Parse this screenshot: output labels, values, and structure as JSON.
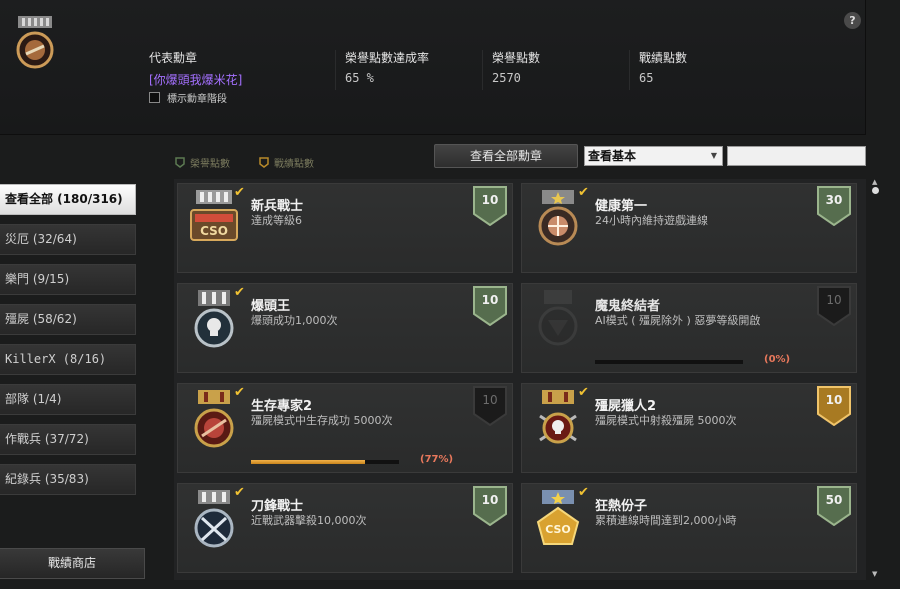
{
  "header": {
    "help_label": "?",
    "representative_medal_label": "代表勳章",
    "representative_medal_value": "[你爆頭我爆米花]",
    "completion_label": "榮譽點數達成率",
    "completion_value": "65 %",
    "honor_points_label": "榮譽點數",
    "honor_points_value": "2570",
    "record_points_label": "戰績點數",
    "record_points_value": "65",
    "show_step_label": "標示勳章階段"
  },
  "toolbar": {
    "legend_honor": "榮譽點數",
    "legend_record": "戰績點數",
    "view_all_button": "查看全部勳章",
    "filter_select": "查看基本",
    "search_value": ""
  },
  "sidebar": {
    "items": [
      {
        "label": "查看全部 (180/316)",
        "active": true
      },
      {
        "label": "災厄 (32/64)",
        "active": false
      },
      {
        "label": "樂門 (9/15)",
        "active": false
      },
      {
        "label": "殭屍 (58/62)",
        "active": false
      },
      {
        "label": "KillerX (8/16)",
        "active": false
      },
      {
        "label": "部隊 (1/4)",
        "active": false
      },
      {
        "label": "作戰兵 (37/72)",
        "active": false
      },
      {
        "label": "紀錄兵 (35/83)",
        "active": false
      }
    ],
    "shop_button": "戰績商店"
  },
  "medals": [
    {
      "title": "新兵戰士",
      "desc": "達成等級6",
      "points": "10",
      "badge": "green",
      "done": true,
      "progress": null,
      "progress_label": ""
    },
    {
      "title": "健康第一",
      "desc": "24小時內維持遊戲連線",
      "points": "30",
      "badge": "green",
      "done": true,
      "progress": null,
      "progress_label": ""
    },
    {
      "title": "爆頭王",
      "desc": "爆頭成功1,000次",
      "points": "10",
      "badge": "green",
      "done": true,
      "progress": null,
      "progress_label": ""
    },
    {
      "title": "魔鬼終結者",
      "desc": "AI模式 ( 殭屍除外 ) 惡夢等級開啟",
      "points": "10",
      "badge": "dark",
      "done": false,
      "progress": 0,
      "progress_label": "(0%)"
    },
    {
      "title": "生存專家2",
      "desc": "殭屍模式中生存成功 5000次",
      "points": "10",
      "badge": "dark",
      "done": true,
      "progress": 0.77,
      "progress_label": "(77%)"
    },
    {
      "title": "殭屍獵人2",
      "desc": "殭屍模式中射殺殭屍 5000次",
      "points": "10",
      "badge": "gold",
      "done": true,
      "progress": null,
      "progress_label": ""
    },
    {
      "title": "刀鋒戰士",
      "desc": "近戰武器擊殺10,000次",
      "points": "10",
      "badge": "green",
      "done": true,
      "progress": null,
      "progress_label": ""
    },
    {
      "title": "狂熱份子",
      "desc": "累積連線時間達到2,000小時",
      "points": "50",
      "badge": "green",
      "done": true,
      "progress": null,
      "progress_label": ""
    }
  ],
  "colors": {
    "badge_green": "#566d4e",
    "badge_gold": "#a87a22",
    "badge_dark": "#1d1d1d",
    "accent_purple": "#a470ff",
    "progress_pct": "#e8785c"
  }
}
